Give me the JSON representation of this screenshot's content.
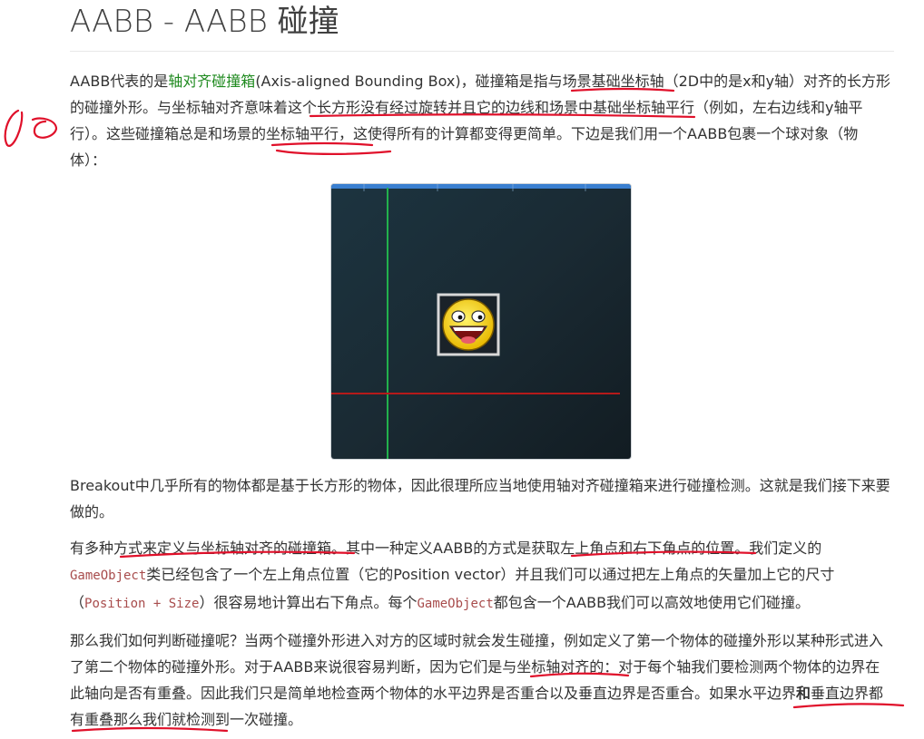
{
  "title": "AABB - AABB 碰撞",
  "para1": {
    "t1": "AABB代表的是",
    "link": "轴对齐碰撞箱",
    "t2": "(Axis-aligned Bounding Box)，碰撞箱是指与场景基础坐标轴（2D中的是x和y轴）对齐的长方形的碰撞外形。与坐标轴对齐意味着这个长方形没有经过旋转并且它的边线和场景中基础坐标轴平行（例如，左右边线和y轴平行）。这些碰撞箱总是和场景的坐标轴平行，这使得所有的计算都变得更简单。下边是我们用一个AABB包裹一个球对象（物体）："
  },
  "figure": {
    "background": "#1b2c35",
    "top_bar_color": "#3a7fd0",
    "green_line_color": "#22b14c",
    "red_line_color": "#b51a1a",
    "box_color": "#d8d8d8",
    "face_color": "#f5d100"
  },
  "para2": "Breakout中几乎所有的物体都是基于长方形的物体，因此很理所应当地使用轴对齐碰撞箱来进行碰撞检测。这就是我们接下来要做的。",
  "para3": {
    "t1": "有多种方式来定义与坐标轴对齐的碰撞箱。其中一种定义AABB的方式是获取左上角点和右下角点的位置。我们定义的",
    "code1": "GameObject",
    "t2": "类已经包含了一个左上角点位置（它的Position vector）并且我们可以通过把左上角点的矢量加上它的尺寸（",
    "code2": "Position + Size",
    "t3": "）很容易地计算出右下角点。每个",
    "code3": "GameObject",
    "t4": "都包含一个AABB我们可以高效地使用它们碰撞。"
  },
  "para4": {
    "t1": "那么我们如何判断碰撞呢？当两个碰撞外形进入对方的区域时就会发生碰撞，例如定义了第一个物体的碰撞外形以某种形式进入了第二个物体的碰撞外形。对于AABB来说很容易判断，因为它们是与坐标轴对齐的：对于每个轴我们要检测两个物体的边界在此轴向是否有重叠。因此我们只是简单地检查两个物体的水平边界是否重合以及垂直边界是否重合。如果水平边界",
    "bold": "和",
    "t2": "垂直边界都有重叠那么我们就检测到一次碰撞。"
  },
  "annotation_color": "#e0102a"
}
